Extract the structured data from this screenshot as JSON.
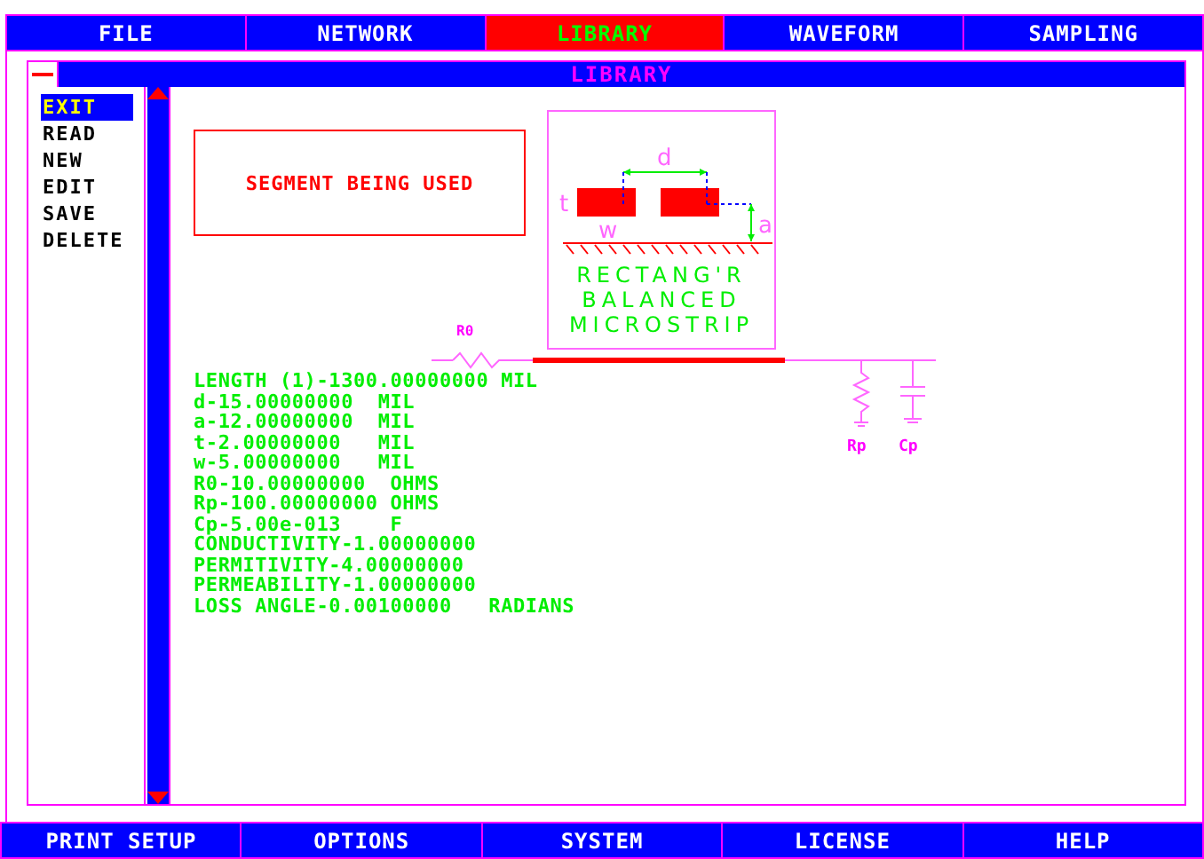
{
  "menu_bar": [
    {
      "label": "FILE",
      "selected": false
    },
    {
      "label": "NETWORK",
      "selected": false
    },
    {
      "label": "LIBRARY",
      "selected": true
    },
    {
      "label": "WAVEFORM",
      "selected": false
    },
    {
      "label": "SAMPLING",
      "selected": false
    }
  ],
  "window": {
    "title": "LIBRARY"
  },
  "commands": [
    {
      "label": "EXIT",
      "selected": true
    },
    {
      "label": "READ",
      "selected": false
    },
    {
      "label": "NEW",
      "selected": false
    },
    {
      "label": "EDIT",
      "selected": false
    },
    {
      "label": "SAVE",
      "selected": false
    },
    {
      "label": "DELETE",
      "selected": false
    }
  ],
  "status_box": "SEGMENT BEING USED",
  "diagram": {
    "labels": {
      "t": "t",
      "d": "d",
      "w": "w",
      "a": "a"
    },
    "caption": [
      "RECTANG'R",
      "BALANCED",
      "MICROSTRIP"
    ]
  },
  "circuit": {
    "r0": "R0",
    "rp": "Rp",
    "cp": "Cp"
  },
  "parameters": [
    "LENGTH (1)-1300.00000000 MIL",
    "d-15.00000000  MIL",
    "a-12.00000000  MIL",
    "t-2.00000000   MIL",
    "w-5.00000000   MIL",
    "R0-10.00000000  OHMS",
    "Rp-100.00000000 OHMS",
    "Cp-5.00e-013    F",
    "CONDUCTIVITY-1.00000000",
    "PERMITIVITY-4.00000000",
    "PERMEABILITY-1.00000000",
    "LOSS ANGLE-0.00100000   RADIANS"
  ],
  "bottom_bar": [
    "PRINT SETUP",
    "OPTIONS",
    "SYSTEM",
    "LICENSE",
    "HELP"
  ]
}
